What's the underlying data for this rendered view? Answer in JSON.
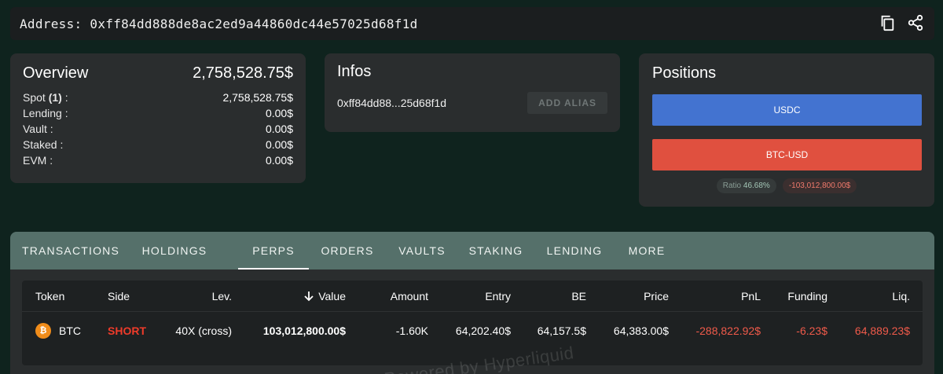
{
  "address": {
    "text": "Address: 0xff84dd888de8ac2ed9a44860dc44e57025d68f1d",
    "copy_icon": "copy-icon",
    "share_icon": "share-icon"
  },
  "overview": {
    "title": "Overview",
    "total": "2,758,528.75$",
    "rows": [
      {
        "label_pre": "Spot ",
        "label_bold": "(1)",
        "label_post": " :",
        "value": "2,758,528.75$"
      },
      {
        "label_pre": "Lending :",
        "label_bold": "",
        "label_post": "",
        "value": "0.00$"
      },
      {
        "label_pre": "Vault :",
        "label_bold": "",
        "label_post": "",
        "value": "0.00$"
      },
      {
        "label_pre": "Staked :",
        "label_bold": "",
        "label_post": "",
        "value": "0.00$"
      },
      {
        "label_pre": "EVM :",
        "label_bold": "",
        "label_post": "",
        "value": "0.00$"
      }
    ]
  },
  "infos": {
    "title": "Infos",
    "short_address": "0xff84dd88...25d68f1d",
    "alias_button": "ADD ALIAS"
  },
  "positions": {
    "title": "Positions",
    "usdc_label": "USDC",
    "btc_label": "BTC-USD",
    "ratio_label": "Ratio",
    "ratio_value": "46.68%",
    "notional": "-103,012,800.00$",
    "colors": {
      "usdc": "#4373d0",
      "btc": "#e0503f"
    }
  },
  "tabs": [
    {
      "label": "TRANSACTIONS",
      "active": false
    },
    {
      "label": "HOLDINGS",
      "active": false
    },
    {
      "label": "PERPS",
      "active": true
    },
    {
      "label": "ORDERS",
      "active": false
    },
    {
      "label": "VAULTS",
      "active": false
    },
    {
      "label": "STAKING",
      "active": false
    },
    {
      "label": "LENDING",
      "active": false
    },
    {
      "label": "MORE",
      "active": false
    }
  ],
  "table": {
    "headers": {
      "token": "Token",
      "side": "Side",
      "lev": "Lev.",
      "value": "Value",
      "amount": "Amount",
      "entry": "Entry",
      "be": "BE",
      "price": "Price",
      "pnl": "PnL",
      "funding": "Funding",
      "liq": "Liq."
    },
    "sort_icon": "arrow-down-icon",
    "rows": [
      {
        "coin_symbol": "₿",
        "token": "BTC",
        "side": "SHORT",
        "lev": "40X (cross)",
        "value": "103,012,800.00$",
        "amount": "-1.60K",
        "entry": "64,202.40$",
        "be": "64,157.5$",
        "price": "64,383.00$",
        "pnl": "-288,822.92$",
        "funding": "-6.23$",
        "liq": "64,889.23$"
      }
    ]
  },
  "watermark": "Powered by Hyperliquid"
}
